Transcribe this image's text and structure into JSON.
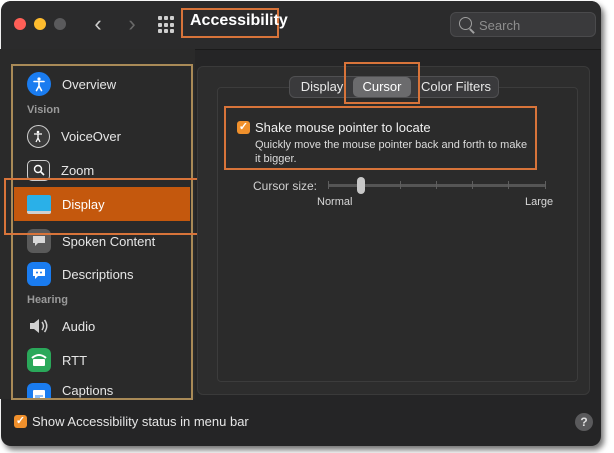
{
  "window": {
    "title": "Accessibility"
  },
  "toolbar": {
    "back_glyph": "‹",
    "forward_glyph": "›"
  },
  "search": {
    "placeholder": "Search"
  },
  "sidebar": {
    "items": [
      {
        "label": "Overview",
        "icon": "accessibility-person-icon",
        "color": "#1a7cf0"
      },
      {
        "label": "VoiceOver",
        "icon": "voiceover-icon",
        "color": "#3a3a3a"
      },
      {
        "label": "Zoom",
        "icon": "zoom-icon",
        "color": "#3a3a3a"
      },
      {
        "label": "Display",
        "icon": "display-icon",
        "color": "#2ab0e8"
      },
      {
        "label": "Spoken Content",
        "icon": "speech-bubble-icon",
        "color": "#5a5a5a"
      },
      {
        "label": "Descriptions",
        "icon": "descriptions-icon",
        "color": "#1a7cf0"
      },
      {
        "label": "Audio",
        "icon": "speaker-icon",
        "color": "#5a5a5a"
      },
      {
        "label": "RTT",
        "icon": "rtt-phone-icon",
        "color": "#2aa85a"
      },
      {
        "label": "Captions",
        "icon": "captions-icon",
        "color": "#1a7cf0"
      }
    ],
    "sections": {
      "vision": "Vision",
      "hearing": "Hearing"
    }
  },
  "tabs": [
    {
      "label": "Display"
    },
    {
      "label": "Cursor",
      "selected": true
    },
    {
      "label": "Color Filters"
    }
  ],
  "cursor": {
    "shake_label": "Shake mouse pointer to locate",
    "shake_checked": true,
    "shake_description": "Quickly move the mouse pointer back and forth to make it bigger.",
    "size_label": "Cursor size:",
    "size_min_label": "Normal",
    "size_max_label": "Large",
    "size_value_fraction": 0.15
  },
  "footer": {
    "status_label": "Show Accessibility status in menu bar",
    "status_checked": true,
    "help_glyph": "?"
  },
  "colors": {
    "accent": "#c4580d",
    "highlight": "#d8743a",
    "checkbox": "#f0902c"
  }
}
